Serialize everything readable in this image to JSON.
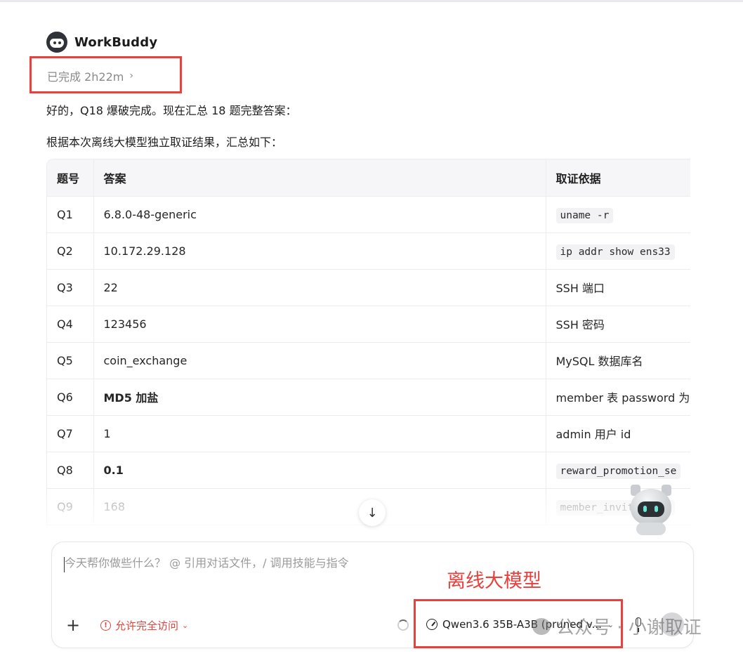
{
  "agent": {
    "name": "WorkBuddy",
    "icon": "robot-avatar-icon"
  },
  "status": {
    "text": "已完成 2h22m",
    "chevron": "›"
  },
  "messages": [
    "好的，Q18 爆破完成。现在汇总 18 题完整答案：",
    "根据本次离线大模型独立取证结果，汇总如下："
  ],
  "table": {
    "headers": [
      "题号",
      "答案",
      "取证依据"
    ],
    "rows": [
      {
        "q": "Q1",
        "answer": "6.8.0-48-generic",
        "basis": "uname -r",
        "basis_code": true,
        "bold": false
      },
      {
        "q": "Q2",
        "answer": "10.172.29.128",
        "basis": "ip addr show ens33",
        "basis_code": true,
        "bold": false
      },
      {
        "q": "Q3",
        "answer": "22",
        "basis": "SSH 端口",
        "basis_code": false,
        "bold": false
      },
      {
        "q": "Q4",
        "answer": "123456",
        "basis": "SSH 密码",
        "basis_code": false,
        "bold": false
      },
      {
        "q": "Q5",
        "answer": "coin_exchange",
        "basis": "MySQL 数据库名",
        "basis_code": false,
        "bold": false
      },
      {
        "q": "Q6",
        "answer": "MD5 加盐",
        "basis": "member 表 password 为",
        "basis_code": false,
        "bold": true
      },
      {
        "q": "Q7",
        "answer": "1",
        "basis": "admin 用户 id",
        "basis_code": false,
        "bold": false
      },
      {
        "q": "Q8",
        "answer": "0.1",
        "basis": "reward_promotion_se",
        "basis_code": true,
        "bold": true
      },
      {
        "q": "Q9",
        "answer": "168",
        "basis": "member_invite_cast",
        "basis_code": true,
        "bold": false
      }
    ]
  },
  "composer": {
    "placeholder": "今天帮你做些什么？ @ 引用对话文件，/ 调用技能与指令",
    "permission_label": "允许完全访问",
    "model_label": "Qwen3.6 35B-A3B (pruned v...",
    "plus": "+",
    "scroll_down": "↓"
  },
  "annotation": {
    "label": "离线大模型",
    "color": "#e8403d"
  },
  "watermark": {
    "text": "公众号 · 小谢取证"
  },
  "colors": {
    "accent_red": "#e8403d",
    "permission_red": "#d9463d",
    "text": "#1f1f1f",
    "muted": "#8a8a8a"
  }
}
